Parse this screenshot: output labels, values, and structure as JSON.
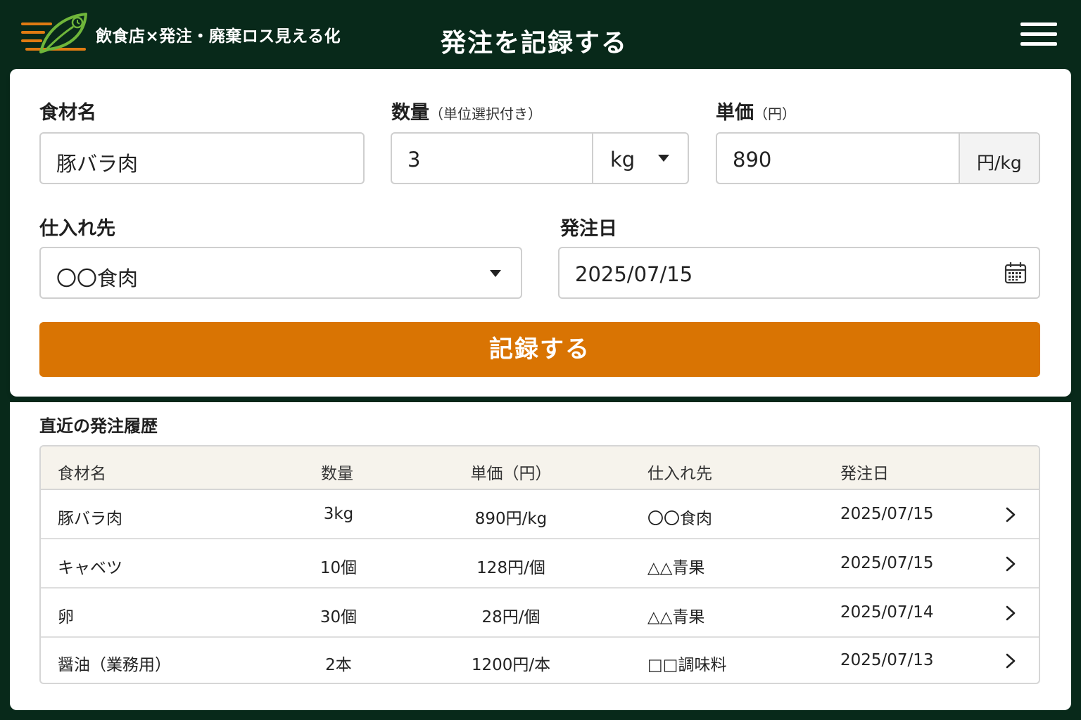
{
  "header": {
    "brand_name": "飲食店×発注・廃棄ロス見える化",
    "page_title": "発注を記録する",
    "logo_icon": "leaf-lines-logo-icon",
    "menu_icon": "hamburger-menu-icon",
    "background_color": "#08291a"
  },
  "form": {
    "ingredient": {
      "label": "食材名",
      "value": "豚バラ肉"
    },
    "quantity": {
      "label": "数量",
      "sublabel": "（単位選択付き）",
      "value": "3",
      "unit": "kg"
    },
    "unit_price": {
      "label": "単価",
      "sublabel": "（円）",
      "value": "890",
      "unit_addon": "円/kg"
    },
    "supplier": {
      "label": "仕入れ先",
      "value": "〇〇食肉"
    },
    "order_date": {
      "label": "発注日",
      "value": "2025/07/15",
      "icon": "calendar-icon"
    },
    "submit_label": "記録する",
    "submit_color": "#d97403"
  },
  "history": {
    "title": "直近の発注履歴",
    "columns": [
      "食材名",
      "数量",
      "単価（円）",
      "仕入れ先",
      "発注日"
    ],
    "rows": [
      {
        "name": "豚バラ肉",
        "qty": "3kg",
        "price": "890円/kg",
        "supplier": "〇〇食肉",
        "date": "2025/07/15"
      },
      {
        "name": "キャベツ",
        "qty": "10個",
        "price": "128円/個",
        "supplier": "△△青果",
        "date": "2025/07/15"
      },
      {
        "name": "卵",
        "qty": "30個",
        "price": "28円/個",
        "supplier": "△△青果",
        "date": "2025/07/14"
      },
      {
        "name": "醤油（業務用）",
        "qty": "2本",
        "price": "1200円/本",
        "supplier": "□□調味料",
        "date": "2025/07/13"
      }
    ],
    "row_icon": "chevron-right-icon"
  }
}
